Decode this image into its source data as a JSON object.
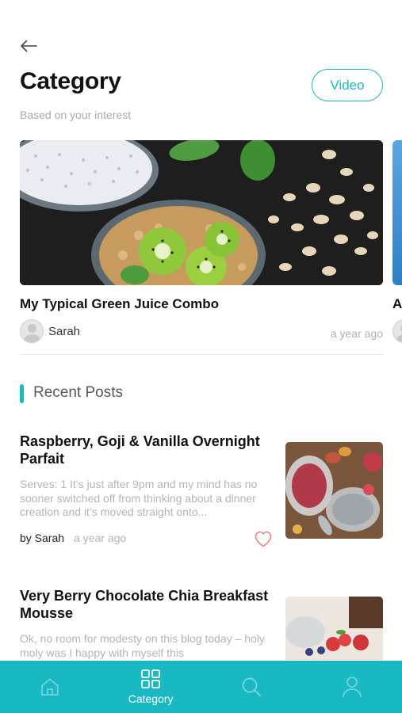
{
  "header": {
    "title": "Category",
    "video_label": "Video",
    "subtitle": "Based on your interest"
  },
  "featured": [
    {
      "title": "My Typical Green Juice Combo",
      "author": "Sarah",
      "time": "a year ago"
    },
    {
      "title": "A",
      "author": "",
      "time": ""
    }
  ],
  "recent": {
    "heading": "Recent Posts",
    "posts": [
      {
        "title": "Raspberry, Goji & Vanilla Overnight Parfait",
        "excerpt": "Serves: 1 It’s just after 9pm and my mind has no sooner switched off from thinking about a dinner creation and it’s moved straight onto...",
        "author": "by Sarah",
        "time": "a year ago"
      },
      {
        "title": "Very Berry Chocolate Chia Breakfast Mousse",
        "excerpt": "Ok, no room for modesty on this blog today – holy moly was I happy with myself this",
        "author": "",
        "time": ""
      }
    ]
  },
  "tabbar": {
    "items": [
      {
        "icon": "home-icon",
        "label": ""
      },
      {
        "icon": "grid-icon",
        "label": "Category"
      },
      {
        "icon": "search-icon",
        "label": ""
      },
      {
        "icon": "profile-icon",
        "label": ""
      }
    ]
  },
  "colors": {
    "accent": "#19b9c3",
    "heart": "#f08080"
  }
}
